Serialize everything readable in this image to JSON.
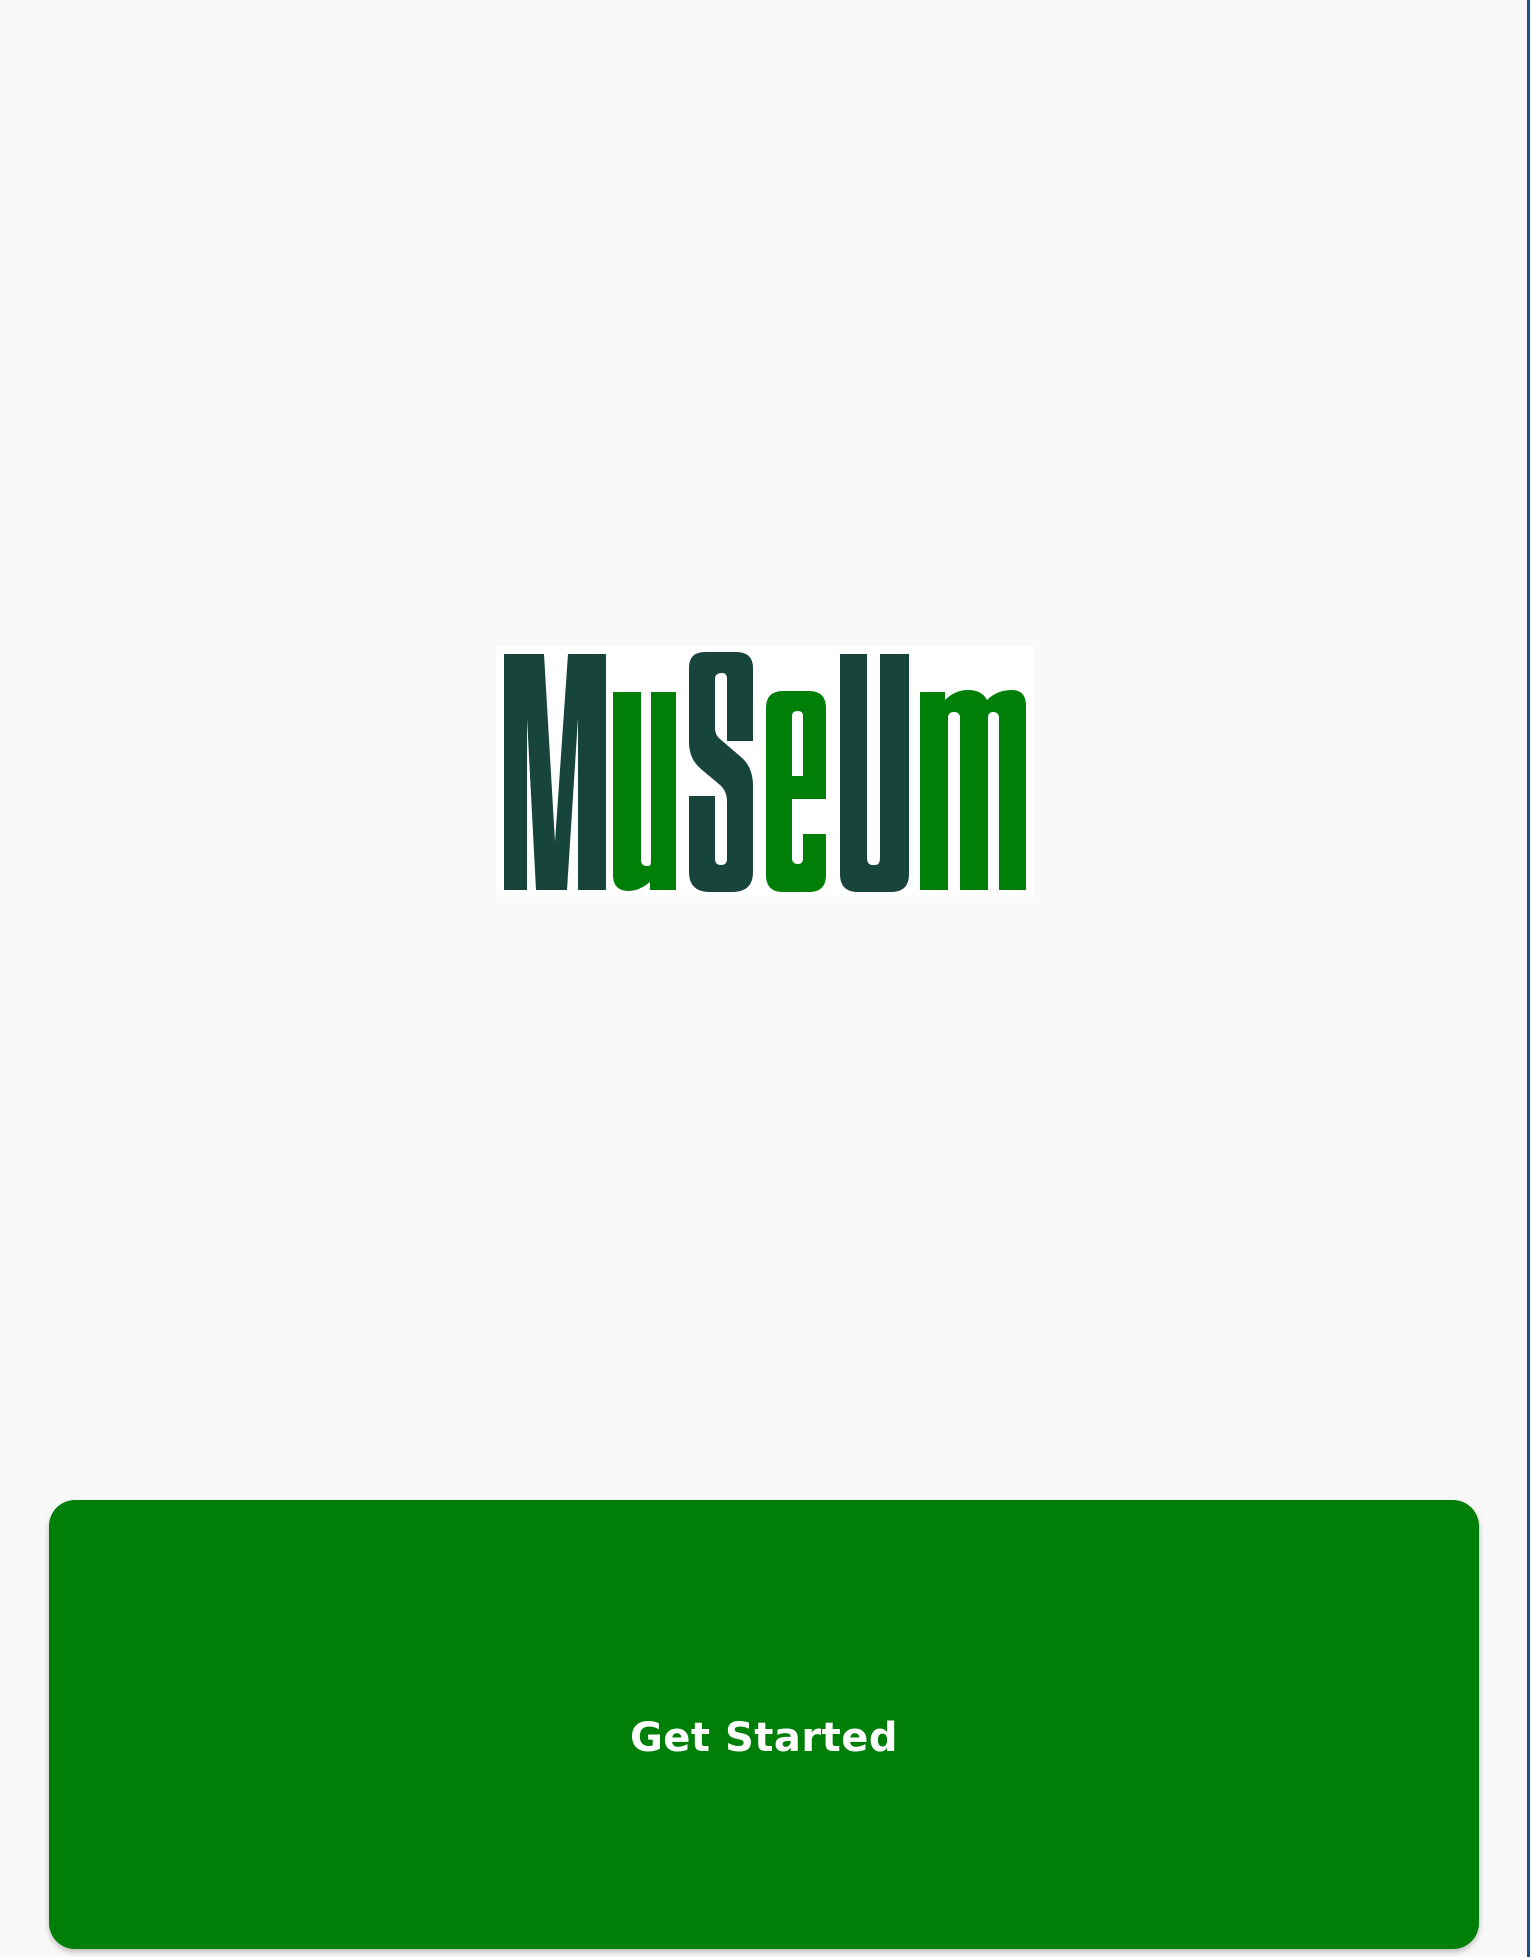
{
  "app": {
    "logo_text": "MuSeUm",
    "logo_icon": "museum-wordmark-logo"
  },
  "actions": {
    "get_started_label": "Get Started"
  },
  "colors": {
    "background": "#f9f9f9",
    "logo_dark_green": "#17453b",
    "logo_green": "#007f08",
    "button_green": "#007f08",
    "button_text": "#ffffff",
    "edge_rule": "#1f4f8a"
  }
}
